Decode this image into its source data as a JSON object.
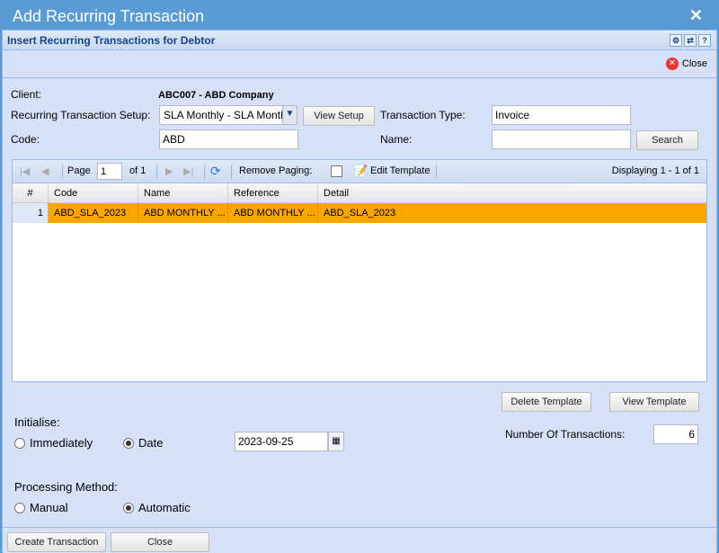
{
  "window": {
    "title": "Add Recurring Transaction",
    "close_icon": "✕"
  },
  "panel": {
    "title": "Insert Recurring Transactions for Debtor",
    "close_label": "Close"
  },
  "form": {
    "client_label": "Client:",
    "client_value": "ABC007 - ABD Company",
    "setup_label": "Recurring Transaction Setup:",
    "setup_value": "SLA Monthly - SLA Monthl",
    "view_setup": "View Setup",
    "type_label": "Transaction Type:",
    "type_value": "Invoice",
    "code_label": "Code:",
    "code_value": "ABD",
    "name_label": "Name:",
    "name_value": "",
    "search": "Search"
  },
  "grid": {
    "page_label": "Page",
    "page_value": "1",
    "of_label": "of 1",
    "remove_paging": "Remove Paging:",
    "edit_template": "Edit Template",
    "displaying": "Displaying 1 - 1 of 1",
    "columns": [
      "#",
      "Code",
      "Name",
      "Reference",
      "Detail"
    ],
    "rows": [
      {
        "num": "1",
        "code": "ABD_SLA_2023",
        "name": "ABD MONTHLY ...",
        "reference": "ABD MONTHLY ...",
        "detail": "ABD_SLA_2023"
      }
    ]
  },
  "actions": {
    "delete_template": "Delete Template",
    "view_template": "View Template"
  },
  "initialise": {
    "label": "Initialise:",
    "immediately": "Immediately",
    "date": "Date",
    "date_value": "2023-09-25",
    "selected": "Date"
  },
  "num_transactions": {
    "label": "Number Of Transactions:",
    "value": "6"
  },
  "processing": {
    "label": "Processing Method:",
    "manual": "Manual",
    "automatic": "Automatic",
    "selected": "Automatic"
  },
  "footer": {
    "create": "Create Transaction",
    "close": "Close"
  }
}
